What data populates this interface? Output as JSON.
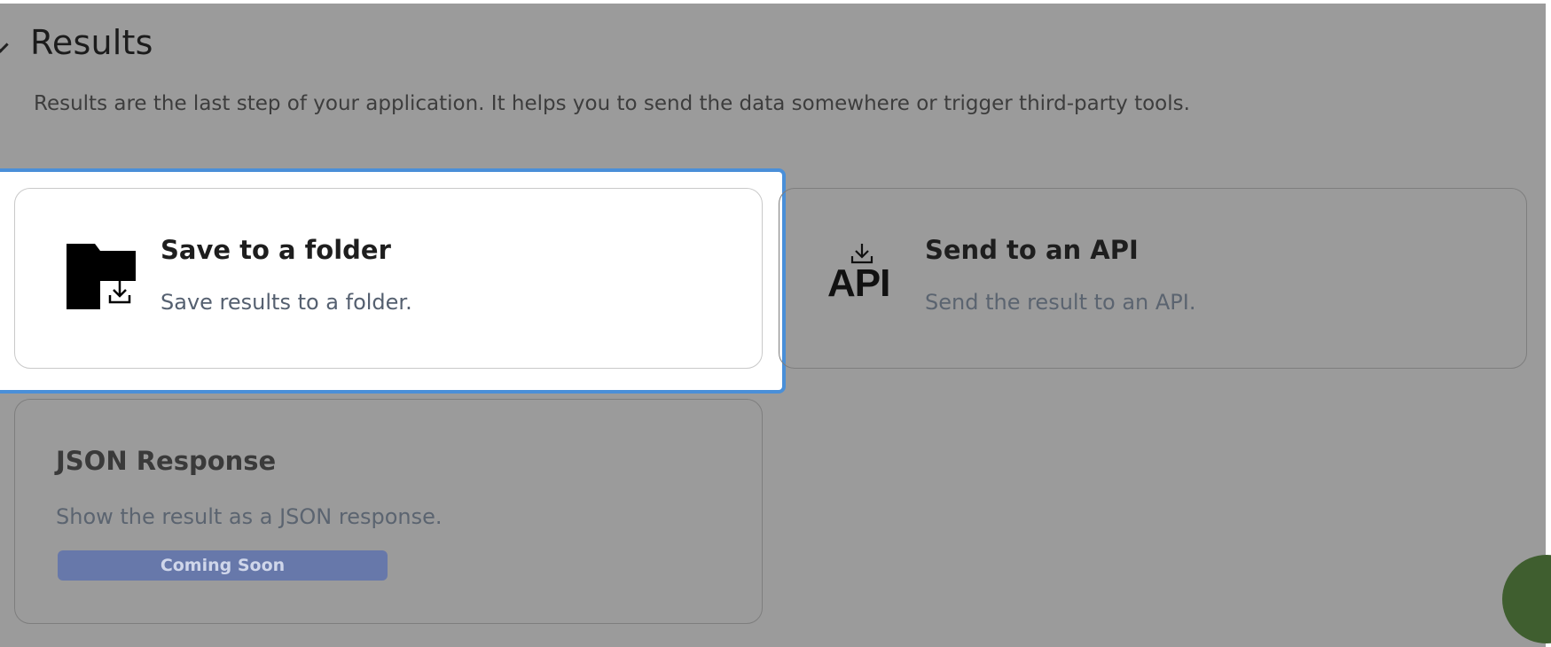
{
  "section": {
    "title": "Results",
    "description": "Results are the last step of your application. It helps you to send the data somewhere or trigger third-party tools."
  },
  "cards": {
    "folder": {
      "title": "Save to a folder",
      "description": "Save results to a folder.",
      "icon": "folder-download-icon",
      "selected": true
    },
    "api": {
      "title": "Send to an API",
      "description": "Send the result to an API.",
      "icon": "api-download-icon",
      "icon_text": "API"
    },
    "json": {
      "title": "JSON Response",
      "description": "Show the result as a JSON response.",
      "badge": "Coming Soon"
    }
  },
  "colors": {
    "overlay": "#9b9b9b",
    "focus_ring": "#4a8fd8",
    "badge_bg": "#6778aa",
    "chat_button": "#3f5e2f"
  },
  "chat": {
    "icon": "chat-bubble-icon"
  }
}
